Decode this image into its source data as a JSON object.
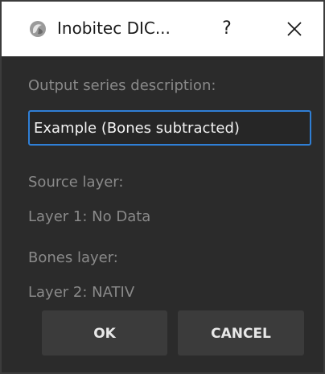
{
  "titlebar": {
    "title": "Inobitec DIC...",
    "help_label": "?",
    "app_icon": "inobitec-logo-icon",
    "close_icon": "close-icon"
  },
  "form": {
    "output_label": "Output series description:",
    "output_value": "Example (Bones subtracted)",
    "source_label": "Source layer:",
    "source_value": "Layer 1: No Data",
    "bones_label": "Bones layer:",
    "bones_value": "Layer 2: NATIV"
  },
  "buttons": {
    "ok": "OK",
    "cancel": "CANCEL"
  },
  "colors": {
    "background": "#2b2b2b",
    "accent": "#2f7fd6",
    "button": "#3b3b3b"
  }
}
